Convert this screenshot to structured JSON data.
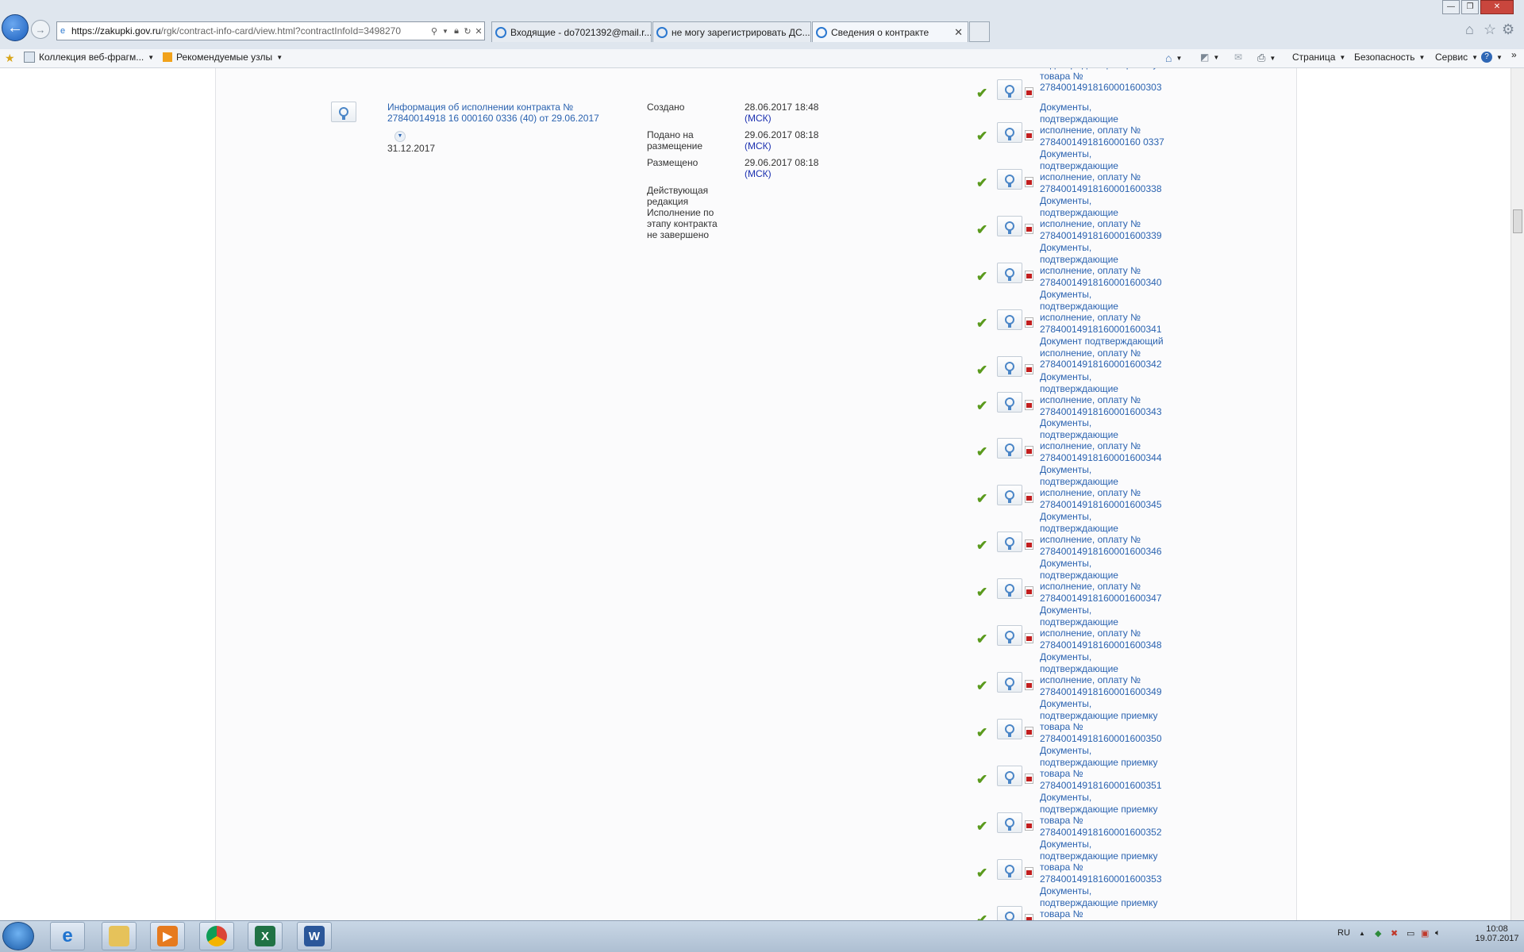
{
  "browser": {
    "url_host": "https://zakupki.gov.ru",
    "url_path": "/rgk/contract-info-card/view.html?contractInfoId=3498270",
    "tabs": [
      {
        "title": "Входящие - do7021392@mail.r...",
        "active": false
      },
      {
        "title": "не могу зарегистрировать ДС...",
        "active": false
      },
      {
        "title": "Сведения о контракте",
        "active": true
      }
    ],
    "favorites": [
      {
        "label": "Коллекция веб-фрагм...",
        "icon": "web-slice-icon"
      },
      {
        "label": "Рекомендуемые узлы",
        "icon": "bing-icon"
      }
    ],
    "command_bar": {
      "page": "Страница",
      "safety": "Безопасность",
      "tools": "Сервис"
    },
    "overflow_glyph": "»"
  },
  "record": {
    "title": "Информация об исполнении контракта № 27840014918 16 000160 0336 (40) от 29.06.2017",
    "end_date": "31.12.2017",
    "meta": [
      {
        "label": "Создано",
        "value": "28.06.2017 18:48",
        "tz": "(МСК)"
      },
      {
        "label": "Подано на размещение",
        "value": "29.06.2017 08:18",
        "tz": "(МСК)"
      },
      {
        "label": "Размещено",
        "value": "29.06.2017 08:18",
        "tz": "(МСК)"
      }
    ],
    "status": "Действующая редакция Исполнение по этапу контракта не завершено"
  },
  "documents": [
    {
      "text": "подтверждающие приемку товара №",
      "number": "278400149181600016​00303",
      "prefix": ""
    },
    {
      "text": "Документы, подтверждающие исполнение, оплату №",
      "number": "2784001491816000160 0337"
    },
    {
      "text": "Документы, подтверждающие исполнение, оплату №",
      "number": "27840014918160001600338"
    },
    {
      "text": "Документы, подтверждающие исполнение, оплату №",
      "number": "27840014918160001600339"
    },
    {
      "text": "Документы, подтверждающие исполнение, оплату №",
      "number": "27840014918160001600340"
    },
    {
      "text": "Документы, подтверждающие исполнение, оплату №",
      "number": "27840014918160001600341"
    },
    {
      "text": "Документ подтверждающий исполнение, оплату №",
      "number": "27840014918160001600342"
    },
    {
      "text": "Документы, подтверждающие исполнение, оплату №",
      "number": "27840014918160001600343"
    },
    {
      "text": "Документы, подтверждающие исполнение, оплату №",
      "number": "27840014918160001600344"
    },
    {
      "text": "Документы, подтверждающие исполнение, оплату №",
      "number": "27840014918160001600345"
    },
    {
      "text": "Документы, подтверждающие исполнение, оплату №",
      "number": "27840014918160001600346"
    },
    {
      "text": "Документы, подтверждающие исполнение, оплату №",
      "number": "27840014918160001600347"
    },
    {
      "text": "Документы, подтверждающие исполнение, оплату №",
      "number": "27840014918160001600348"
    },
    {
      "text": "Документы, подтверждающие исполнение, оплату №",
      "number": "27840014918160001600349"
    },
    {
      "text": "Документы, подтверждающие приемку товара №",
      "number": "27840014918160001600350"
    },
    {
      "text": "Документы, подтверждающие приемку товара №",
      "number": "27840014918160001600351"
    },
    {
      "text": "Документы, подтверждающие приемку товара №",
      "number": "27840014918160001600352"
    },
    {
      "text": "Документы, подтверждающие приемку товара №",
      "number": "27840014918160001600353"
    },
    {
      "text": "Документы, подтверждающие приемку товара №",
      "number": ""
    }
  ],
  "taskbar": {
    "apps": [
      "start-orb",
      "internet-explorer",
      "file-explorer",
      "media-player",
      "chrome",
      "excel",
      "word"
    ],
    "lang": "RU",
    "time": "10:08",
    "date": "19.07.2017"
  },
  "colors": {
    "link": "#2b63b0",
    "msk": "#1a2fb0",
    "check": "#5a9a1d",
    "pdf": "#c21e1e"
  }
}
